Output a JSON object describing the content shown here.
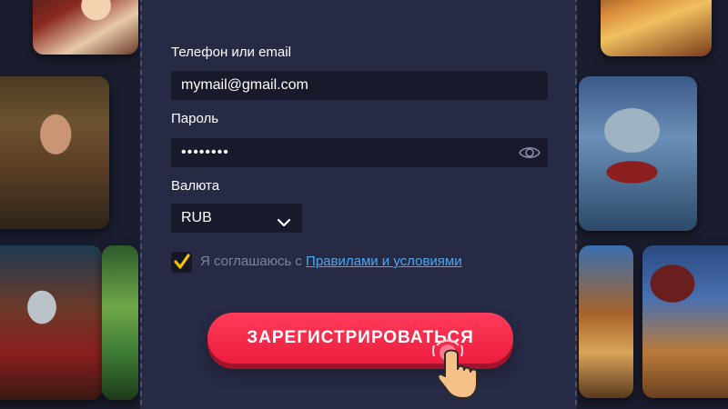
{
  "form": {
    "login_label": "Телефон или email",
    "login_value": "mymail@gmail.com",
    "password_label": "Пароль",
    "password_value": "••••••••",
    "currency_label": "Валюта",
    "currency_value": "RUB",
    "agree_prefix": "Я соглашаюсь с ",
    "agree_link": "Правилами и условиями",
    "agree_checked": true,
    "register_label": "ЗАРЕГИСТРИРОВАТЬСЯ"
  },
  "icons": {
    "password_toggle": "eye-icon",
    "currency_dropdown": "chevron-down-icon",
    "checkbox_mark": "checkmark-icon",
    "pointer": "hand-pointer-icon"
  },
  "colors": {
    "background": "#1a1d2e",
    "panel": "#272a45",
    "field": "#181a2b",
    "accent_button": "#ec1d3f",
    "checkmark": "#f5c400",
    "link": "#4aa8f0",
    "muted_text": "#7e829c"
  }
}
